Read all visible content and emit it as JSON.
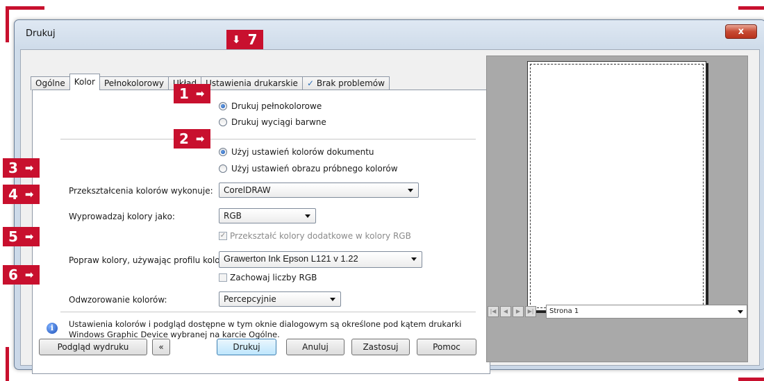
{
  "window": {
    "title": "Drukuj",
    "close_label": "x"
  },
  "tabs": [
    {
      "label": "Ogólne"
    },
    {
      "label": "Kolor"
    },
    {
      "label": "Pełnokolorowy"
    },
    {
      "label": "Układ"
    },
    {
      "label": "Ustawienia drukarskie"
    },
    {
      "label": "Brak problemów"
    }
  ],
  "output_mode": {
    "option1": "Drukuj pełnokolorowe",
    "option2": "Drukuj wyciągi barwne",
    "selected": "Drukuj pełnokolorowe"
  },
  "color_source": {
    "option1": "Użyj ustawień kolorów dokumentu",
    "option2": "Użyj ustawień obrazu próbnego kolorów",
    "selected": "Użyj ustawień kolorów dokumentu"
  },
  "fields": {
    "conversion_label": "Przekształcenia kolorów wykonuje:",
    "conversion_value": "CorelDRAW",
    "output_label": "Wyprowadzaj kolory jako:",
    "output_value": "RGB",
    "spot_check": "Przekształć kolory dodatkowe w kolory RGB",
    "profile_label": "Popraw kolory, używając profilu kolorów:",
    "profile_value": "Grawerton Ink Epson L121 v 1.22",
    "keep_rgb": "Zachowaj liczby RGB",
    "intent_label": "Odwzorowanie kolorów:",
    "intent_value": "Percepcyjnie"
  },
  "info": {
    "line1": "Ustawienia kolorów i podgląd dostępne w tym oknie dialogowym są określone pod kątem drukarki",
    "line2": "Windows Graphic Device wybranej na karcie Ogólne."
  },
  "buttons": {
    "preview": "Podgląd wydruku",
    "toggle": "«",
    "print": "Drukuj",
    "cancel": "Anuluj",
    "apply": "Zastosuj",
    "help": "Pomoc"
  },
  "preview": {
    "page_label": "Strona 1"
  },
  "badges": {
    "b1": "1",
    "b2": "2",
    "b3": "3",
    "b4": "4",
    "b5": "5",
    "b6": "6",
    "b7": "7"
  },
  "colors": {
    "accent": "#c8102e",
    "window_frame": "#cbd8e8"
  }
}
